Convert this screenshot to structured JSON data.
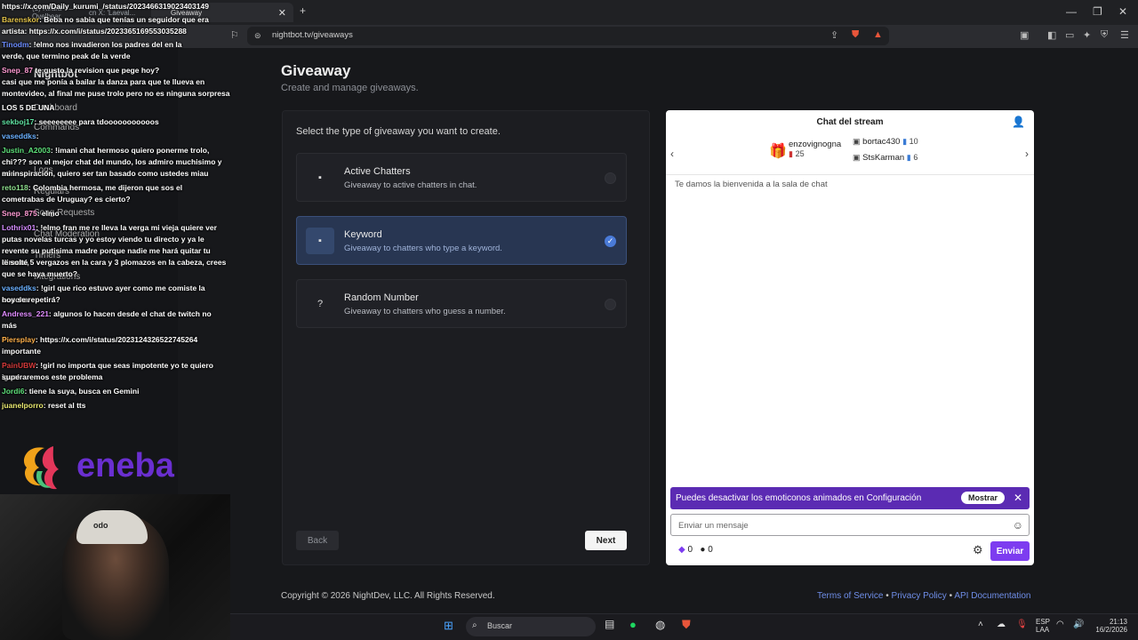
{
  "browser": {
    "tabs": [
      "(1) Kirara-Ovelbear",
      "cn X: 'Laeval...",
      "Giveaway"
    ],
    "url": "nightbot.tv/giveaways"
  },
  "sidebar": {
    "items": [
      "Nightbot",
      "Dashboard",
      "Commands",
      "Logs",
      "Regulars",
      "Song Requests",
      "Chat Moderation",
      "Timers",
      "Integrations"
    ]
  },
  "page": {
    "title": "Giveaway",
    "subtitle": "Create and manage giveaways.",
    "prompt": "Select the type of giveaway you want to create.",
    "options": [
      {
        "title": "Active Chatters",
        "desc": "Giveaway to active chatters in chat.",
        "selected": false
      },
      {
        "title": "Keyword",
        "desc": "Giveaway to chatters who type a keyword.",
        "selected": true
      },
      {
        "title": "Random Number",
        "desc": "Giveaway to chatters who guess a number.",
        "selected": false
      }
    ],
    "back_label": "Back",
    "next_label": "Next"
  },
  "chat": {
    "title": "Chat del stream",
    "leaders": [
      {
        "name": "enzovignogna",
        "count": "25"
      },
      {
        "name": "bortac430",
        "count": "10"
      },
      {
        "name": "StsKarman",
        "count": "6"
      }
    ],
    "welcome": "Te damos la bienvenida a la sala de chat",
    "notice": "Puedes desactivar los emoticonos animados en Configuración",
    "notice_button": "Mostrar",
    "input_placeholder": "Enviar un mensaje",
    "points_a": "0",
    "points_b": "0",
    "send_label": "Enviar"
  },
  "footer": {
    "copyright": "Copyright © 2026 NightDev, LLC. All Rights Reserved.",
    "links": [
      "Terms of Service",
      "Privacy Policy",
      "API Documentation"
    ],
    "sep": "•"
  },
  "overlay": {
    "lines": [
      {
        "user": "",
        "text": "https://x.com/Daily_kurumi_/status/2023466319023403149"
      },
      {
        "user": "Barenskor",
        "text": ": Beba no sabia que tenías un seguidor que era"
      },
      {
        "user": "",
        "text": "artista: https://x.com/i/status/2023365169553035288"
      },
      {
        "user": "Tinodm",
        "text": ": !elmo nos invadieron los padres del        en la"
      },
      {
        "user": "",
        "text": "verde, que termino peak de la verde"
      },
      {
        "user": "Snep_87",
        "text": "                te gusto la revision que pege hoy?"
      },
      {
        "user": "",
        "text": "casi que me ponía a bailar la danza para que te llueva en"
      },
      {
        "user": "",
        "text": "montevideo, al final me puse trolo pero no es ninguna sorpresa"
      },
      {
        "user": "",
        "text": "             LOS 5 DE UNA"
      },
      {
        "user": "sekboj17",
        "text": ": seeeeeeee para tdooooooooooos"
      },
      {
        "user": "vaseddks",
        "text": ":"
      },
      {
        "user": "Justin_A2003",
        "text": ": !imani chat hermoso quiero ponerme trolo,"
      },
      {
        "user": "",
        "text": "chi??? son el mejor chat del mundo, los admiro muchisimo y son"
      },
      {
        "user": "",
        "text": "mi inspiración, quiero ser tan basado como ustedes miau"
      },
      {
        "user": "reto118",
        "text": ": Colombia         hermosa, me dijeron que sos el"
      },
      {
        "user": "",
        "text": "cometrabas de Uruguay? es cierto?"
      },
      {
        "user": "Snep_875",
        "text": ": elmo"
      },
      {
        "user": "Lothrix01",
        "text": ": !elmo fran me re lleva la     verga mi vieja quiere ver"
      },
      {
        "user": "",
        "text": "putas novelas turcas y yo estoy viendo tu directo y ya le"
      },
      {
        "user": "",
        "text": "revente su putisima madre porque nadie me hará quitar tu directo,"
      },
      {
        "user": "",
        "text": "le solté 5 vergazos en la cara y 3 plomazos en la cabeza, crees"
      },
      {
        "user": "",
        "text": "que se haya muerto?"
      },
      {
        "user": "vaseddks",
        "text": ": !girl que rico estuvo ayer como me comiste la concha"
      },
      {
        "user": "",
        "text": "hoy se repetirá?"
      },
      {
        "user": "Andress_221",
        "text": ": algunos lo hacen desde el chat de twitch no"
      },
      {
        "user": "",
        "text": "más"
      },
      {
        "user": "Piersplay",
        "text": ": https://x.com/i/status/2023124326522745264"
      },
      {
        "user": "",
        "text": "importante"
      },
      {
        "user": "PainUBW",
        "text": ": !girl no importa que seas impotente yo te quiero igual"
      },
      {
        "user": "",
        "text": "superaremos este problema"
      },
      {
        "user": "Jordi6",
        "text": ":     tiene la suya, busca en Gemini"
      },
      {
        "user": "juanelporro",
        "text": ": reset al tts"
      }
    ],
    "logo": "eneba",
    "cap_text": "odo"
  },
  "taskbar": {
    "search": "Buscar",
    "lang": "ESP",
    "lang2": "LAA",
    "time": "21:13",
    "date": "16/2/2026"
  }
}
